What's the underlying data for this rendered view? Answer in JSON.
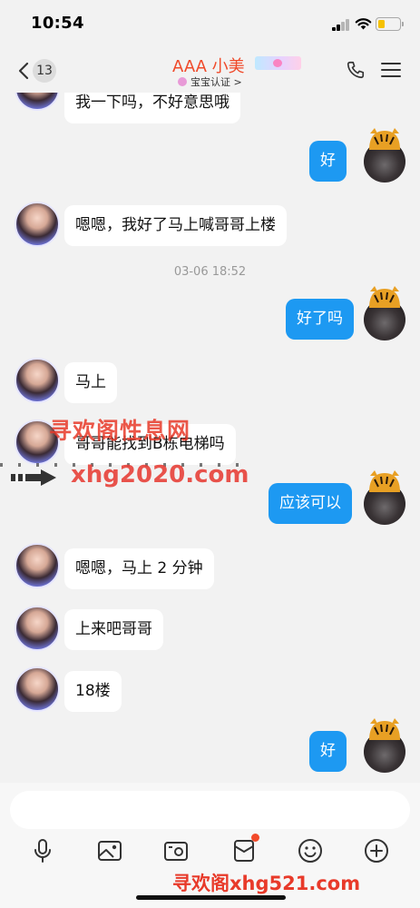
{
  "status_bar": {
    "time": "10:54",
    "battery_percent": 35
  },
  "header": {
    "back_count": "13",
    "contact_name": "AAA 小美",
    "certification": "宝宝认证",
    "certification_chevron": ">",
    "icons": {
      "back": "chevron-left-icon",
      "phone": "phone-icon",
      "menu": "menu-icon"
    }
  },
  "chat": {
    "timestamp": "03-06 18:52",
    "messages": [
      {
        "side": "in",
        "text": "我一下吗，不好意思哦"
      },
      {
        "side": "out",
        "text": "好"
      },
      {
        "side": "in",
        "text": "嗯嗯，我好了马上喊哥哥上楼"
      },
      {
        "side": "out",
        "text": "好了吗"
      },
      {
        "side": "in",
        "text": "马上"
      },
      {
        "side": "in",
        "text": "哥哥能找到B栋电梯吗"
      },
      {
        "side": "out",
        "text": "应该可以"
      },
      {
        "side": "in",
        "text": "嗯嗯，马上 2 分钟"
      },
      {
        "side": "in",
        "text": "上来吧哥哥"
      },
      {
        "side": "in",
        "text": "18楼"
      },
      {
        "side": "out",
        "text": "好"
      }
    ]
  },
  "watermarks": {
    "top": "寻欢阁性息网",
    "mid": "xhg2020.com",
    "bottom": "寻欢阁xhg521.com"
  },
  "input": {
    "placeholder": ""
  },
  "toolbar": {
    "items": [
      "microphone-icon",
      "image-icon",
      "camera-icon",
      "red-packet-icon",
      "emoji-icon",
      "plus-icon"
    ],
    "accent_color": "#1d99f2",
    "badge_color": "#f24a2a"
  }
}
